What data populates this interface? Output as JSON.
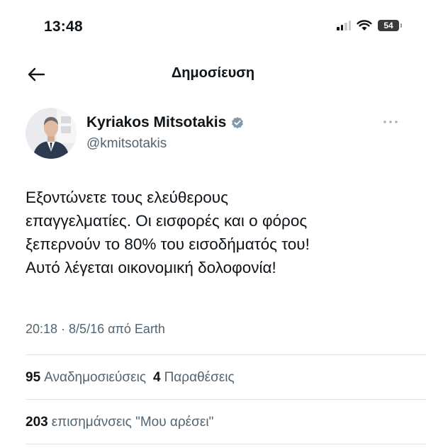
{
  "status_bar": {
    "time": "13:48",
    "battery": "54",
    "icons": [
      "signal-icon",
      "wifi-icon",
      "battery-icon"
    ]
  },
  "header": {
    "title": "Δημοσίευση",
    "back_icon": "arrow-left-icon"
  },
  "tweet": {
    "author": {
      "name": "Kyriakos Mitsotakis",
      "handle": "@kmitsotakis",
      "verified": true
    },
    "text_lines": [
      "Εξοντώνετε τους ελεύθερους",
      "επαγγελματίες. Οι εισφορές και ο φόρος",
      "ξεπερνούν το 80% του εισοδήματός του!",
      "Αυτό λέγεται οικονομική δολοφονία!"
    ],
    "meta": "20:18 · 8/5/16 από Earth",
    "stats": {
      "reposts_count": "95",
      "reposts_label": "Αναδημοσιεύσεις",
      "quotes_count": "4",
      "quotes_label": "Παραθέσεις",
      "likes_count": "203",
      "likes_label": "επισημάνσεις \"Μου αρέσει\""
    }
  },
  "colors": {
    "text_primary": "#0f1419",
    "text_secondary": "#536471",
    "divider": "#e3e6e8",
    "verified_badge": "#829aab"
  }
}
